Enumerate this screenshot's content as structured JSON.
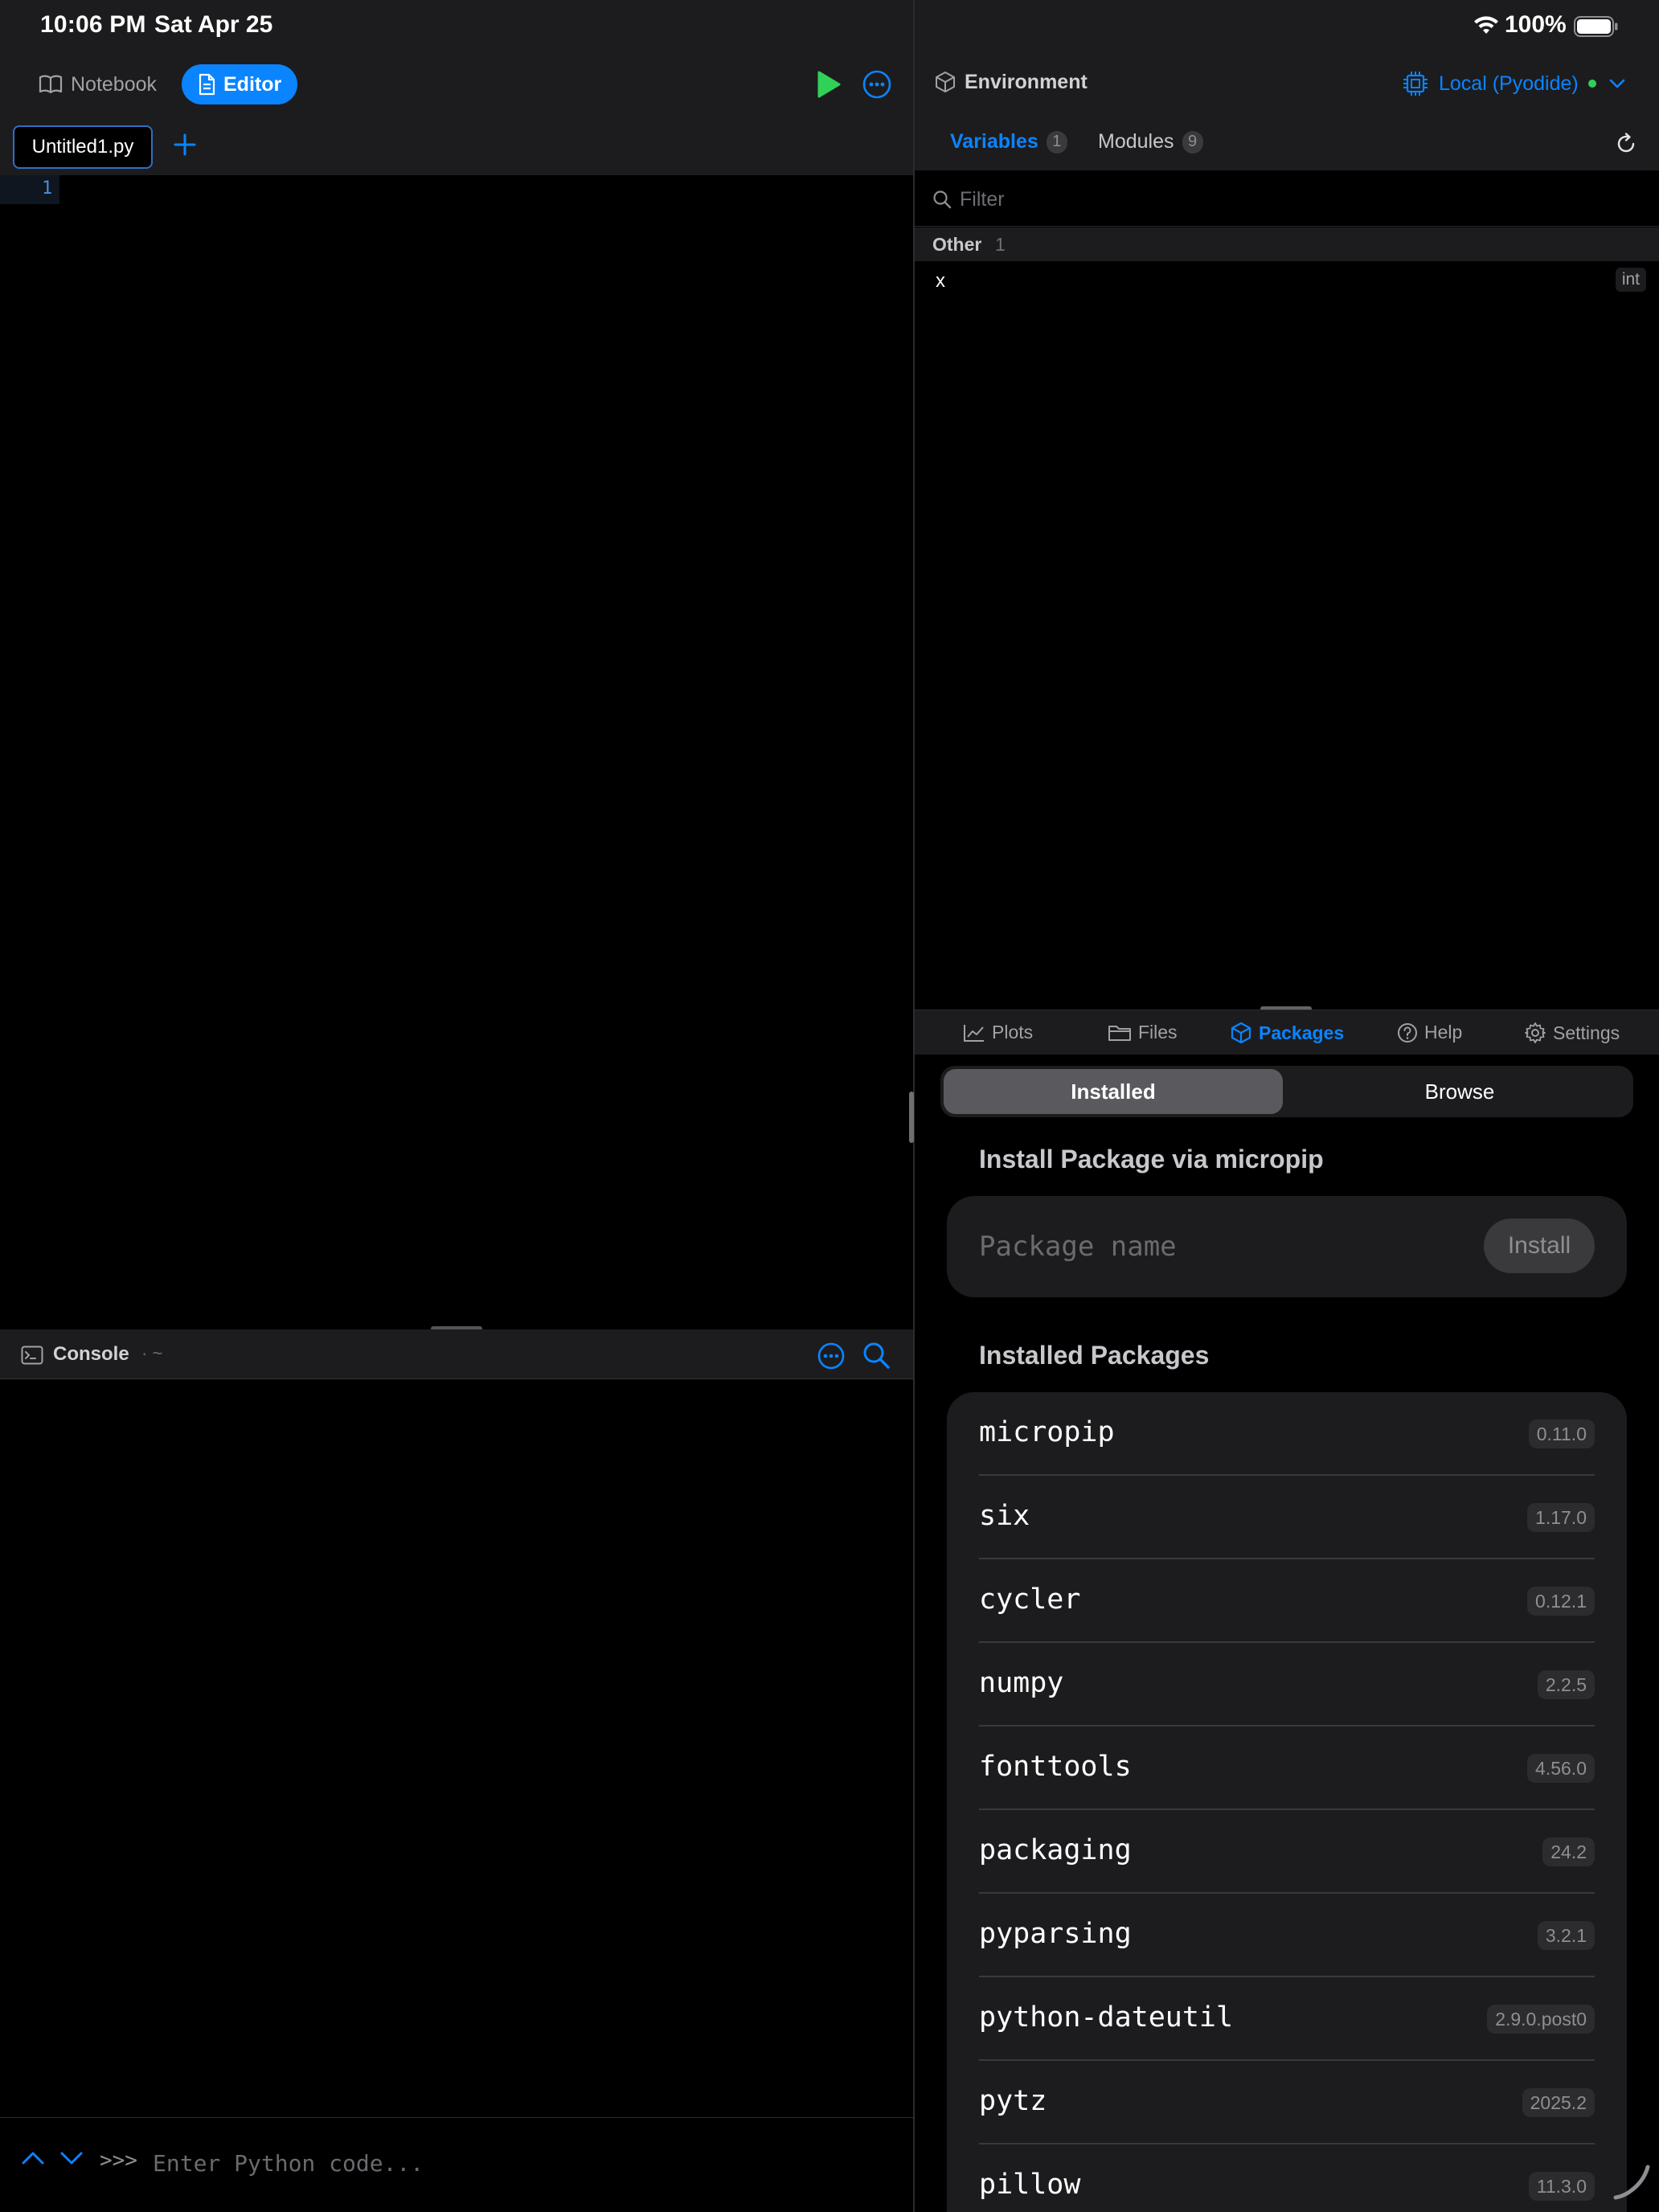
{
  "status_bar": {
    "time": "10:06 PM",
    "date": "Sat Apr 25",
    "battery": "100%"
  },
  "left_toolbar": {
    "notebook_label": "Notebook",
    "editor_label": "Editor"
  },
  "editor": {
    "tab_name": "Untitled1.py",
    "line_numbers": [
      "1"
    ]
  },
  "console": {
    "title": "Console",
    "path": "· ~",
    "prompt": ">>>",
    "placeholder": "Enter Python code..."
  },
  "environment": {
    "title": "Environment",
    "kernel": "Local (Pyodide)",
    "tabs": {
      "variables": "Variables",
      "variables_count": "1",
      "modules": "Modules",
      "modules_count": "9"
    },
    "filter_placeholder": "Filter",
    "group": {
      "name": "Other",
      "count": "1"
    },
    "variables": [
      {
        "name": "x",
        "type": "int"
      }
    ]
  },
  "bottom_tabs": {
    "plots": "Plots",
    "files": "Files",
    "packages": "Packages",
    "help": "Help",
    "settings": "Settings"
  },
  "packages": {
    "segment_installed": "Installed",
    "segment_browse": "Browse",
    "install_title": "Install Package via micropip",
    "input_placeholder": "Package name",
    "install_button": "Install",
    "installed_title": "Installed Packages",
    "list": [
      {
        "name": "micropip",
        "version": "0.11.0"
      },
      {
        "name": "six",
        "version": "1.17.0"
      },
      {
        "name": "cycler",
        "version": "0.12.1"
      },
      {
        "name": "numpy",
        "version": "2.2.5"
      },
      {
        "name": "fonttools",
        "version": "4.56.0"
      },
      {
        "name": "packaging",
        "version": "24.2"
      },
      {
        "name": "pyparsing",
        "version": "3.2.1"
      },
      {
        "name": "python-dateutil",
        "version": "2.9.0.post0"
      },
      {
        "name": "pytz",
        "version": "2025.2"
      },
      {
        "name": "pillow",
        "version": "11.3.0"
      }
    ]
  },
  "colors": {
    "accent": "#0a84ff",
    "run": "#30d158",
    "status_ok": "#30d158"
  }
}
